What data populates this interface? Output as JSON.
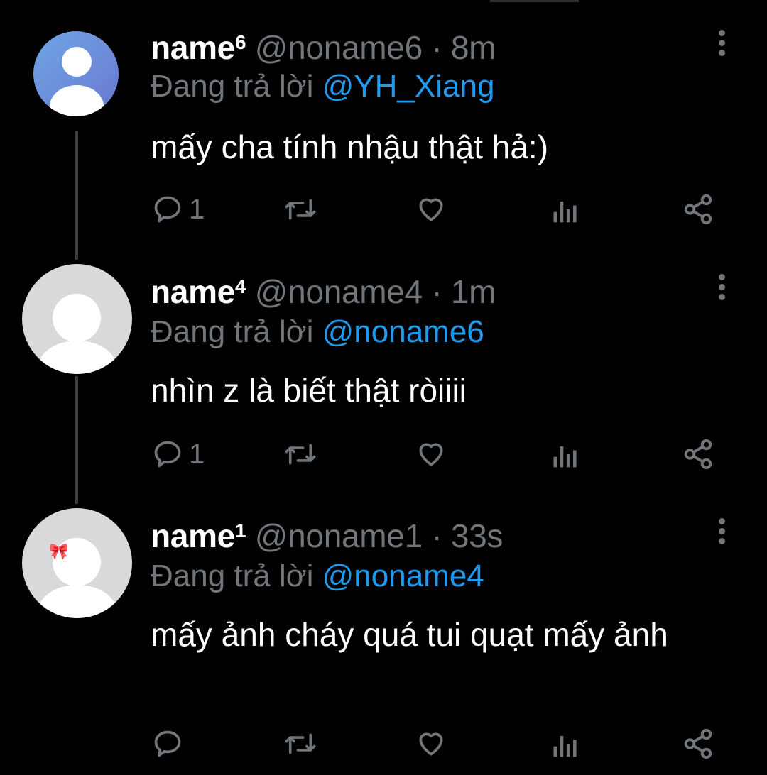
{
  "tweets": [
    {
      "name": "name",
      "name_sup": "6",
      "handle": "@noname6",
      "separator": "·",
      "time": "8m",
      "reply_prefix": "Đang trả lời",
      "reply_to": "@YH_Xiang",
      "text": "mấy cha tính nhậu thật hả:)",
      "reply_count": "1",
      "avatar_color": "#6a8fd8",
      "icons": [
        "reply-icon",
        "retweet-icon",
        "like-icon",
        "views-icon",
        "share-icon",
        "more-icon"
      ]
    },
    {
      "name": "name",
      "name_sup": "4",
      "handle": "@noname4",
      "separator": "·",
      "time": "1m",
      "reply_prefix": "Đang trả lời",
      "reply_to": "@noname6",
      "text": "nhìn z là biết thật ròiiii",
      "reply_count": "1",
      "avatar_color": "#d9d9d9",
      "icons": [
        "reply-icon",
        "retweet-icon",
        "like-icon",
        "views-icon",
        "share-icon",
        "more-icon"
      ]
    },
    {
      "name": "name",
      "name_sup": "1",
      "handle": "@noname1",
      "separator": "·",
      "time": "33s",
      "reply_prefix": "Đang trả lời",
      "reply_to": "@noname4",
      "text": "mấy ảnh cháy quá tui quạt mấy ảnh",
      "reply_count": "",
      "avatar_color": "#d9d9d9",
      "avatar_decoration": "🎀",
      "icons": [
        "reply-icon",
        "retweet-icon",
        "like-icon",
        "views-icon",
        "share-icon",
        "more-icon"
      ]
    }
  ],
  "colors": {
    "background": "#000000",
    "text": "#ffffff",
    "muted": "#71767b",
    "accent": "#1d9bf0",
    "thread_line": "#3e4144"
  }
}
